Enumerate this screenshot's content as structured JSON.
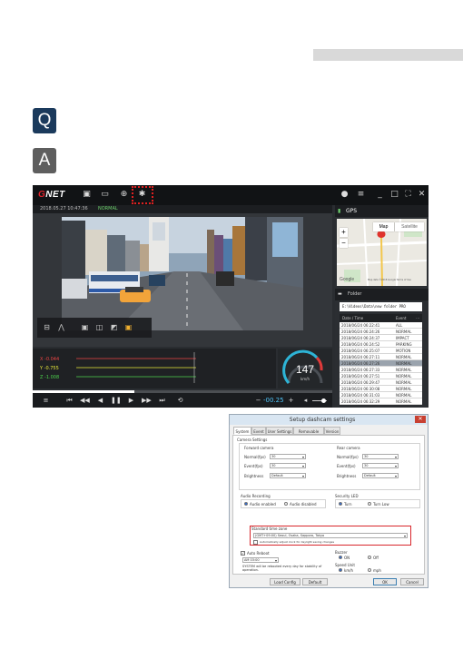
{
  "qa": {
    "q": "Q",
    "a": "A"
  },
  "viewer": {
    "brand": {
      "g": "G",
      "rest": "NET"
    },
    "recording_info": "2018.05.27  10:47:36",
    "recording_mode": "NORMAL",
    "graph": {
      "x": "X  -0.044",
      "y": "Y  -0.755",
      "z": "Z  -1.008"
    },
    "speed": {
      "value": "147",
      "unit": "km/h"
    },
    "playback": {
      "time": "-00.25",
      "progress_percent": 34
    },
    "gps_panel": {
      "title": "GPS"
    },
    "map": {
      "tab_map": "Map",
      "tab_satellite": "Satellite",
      "zoom_in": "+",
      "zoom_out": "−",
      "attribution": "Google",
      "terms": "Map data ©2018 Google  Terms of Use"
    },
    "folder_panel": {
      "title": "Folder"
    },
    "file_path": "E:\\Videos\\Data\\new folder PRO",
    "file_list": {
      "col_date": "Date / Time",
      "col_event": "Event",
      "rows": [
        {
          "date": "2018/06/24 06:22:41",
          "type": "ALL"
        },
        {
          "date": "2018/06/24 06:24:26",
          "type": "NORMAL"
        },
        {
          "date": "2018/06/24 06:24:37",
          "type": "IMPACT"
        },
        {
          "date": "2018/06/24 06:24:52",
          "type": "PARKING"
        },
        {
          "date": "2018/06/24 06:25:07",
          "type": "MOTION"
        },
        {
          "date": "2018/06/24 06:27:11",
          "type": "NORMAL"
        },
        {
          "date": "2018/06/24 06:27:26",
          "type": "NORMAL"
        },
        {
          "date": "2018/06/24 06:27:33",
          "type": "NORMAL"
        },
        {
          "date": "2018/06/24 06:27:51",
          "type": "NORMAL"
        },
        {
          "date": "2018/06/24 06:29:47",
          "type": "NORMAL"
        },
        {
          "date": "2018/06/24 06:30:08",
          "type": "NORMAL"
        },
        {
          "date": "2018/06/24 06:31:03",
          "type": "NORMAL"
        },
        {
          "date": "2018/06/24 06:32:29",
          "type": "NORMAL"
        }
      ]
    }
  },
  "settings_dialog": {
    "title": "Setup dashcam settings",
    "close": "✕",
    "tabs": [
      "System",
      "Event",
      "User Settings",
      "Removable Disk",
      "Version"
    ],
    "camera_settings": "Camera Settings",
    "front": {
      "title": "Forward camera",
      "normal_label": "Normal(fps)",
      "normal_value": "30",
      "event_label": "Event(fps)",
      "event_value": "30",
      "brightness_label": "Brightness",
      "brightness_value": "Default"
    },
    "rear": {
      "title": "Rear camera",
      "normal_label": "Normal(fps)",
      "normal_value": "30",
      "event_label": "Event(fps)",
      "event_value": "30",
      "brightness_label": "Brightness",
      "brightness_value": "Default"
    },
    "audio": {
      "title": "Audio Recording",
      "opt1": "Audio enabled",
      "opt2": "Audio disabled"
    },
    "security": {
      "title": "Security LED",
      "opt1": "Turn",
      "opt2": "Turn Low"
    },
    "timezone": {
      "title": "Standard time zone",
      "value": "(GMT+09:00) Seoul, Osaka, Sapporo, Tokyo",
      "auto_label": "Automatically adjust clock for daylight saving changes"
    },
    "reboot": {
      "label": "Auto Reboot",
      "time": "AM 03:00",
      "note": "SYSTEM will be rebooted every day for stability of operation."
    },
    "buzzer": {
      "title": "Buzzer",
      "on": "ON",
      "off": "Off"
    },
    "speed_unit": {
      "title": "Speed Unit",
      "opt1": "km/h",
      "opt2": "mph"
    },
    "buttons": {
      "load": "Load Config",
      "default": "Default",
      "ok": "OK",
      "cancel": "Cancel"
    }
  }
}
